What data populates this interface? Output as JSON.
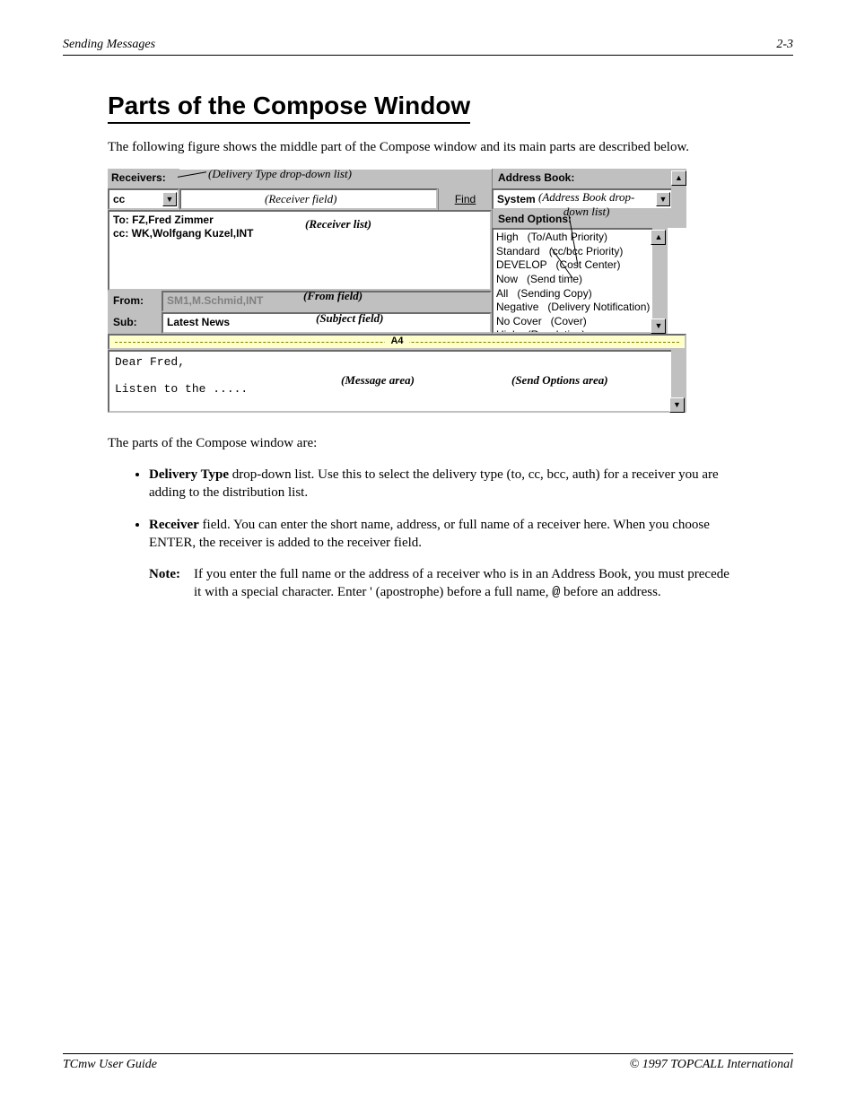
{
  "header": {
    "left": "Sending Messages",
    "right": "2-3"
  },
  "section_title": "Parts of the Compose Window",
  "intro": "The following figure shows the middle part of the Compose window and its main parts are described below.",
  "ui": {
    "receivers_label": "Receivers:",
    "address_book_label": "Address Book:",
    "delivery_type_value": "cc",
    "find_label": "Find",
    "address_book_value": "System",
    "receiver_list": "To: FZ,Fred Zimmer\ncc: WK,Wolfgang Kuzel,INT",
    "send_options_label": "Send Options:",
    "send_options": "High   (To/Auth Priority)\nStandard   (cc/bcc Priority)\nDEVELOP   (Cost Center)\nNow   (Send time)\nAll   (Sending Copy)\nNegative   (Delivery Notification)\nNo Cover   (Cover)\nHigh   (Resolution)",
    "from_label": "From:",
    "from_value": "SM1,M.Schmid,INT",
    "sub_label": "Sub:",
    "sub_value": "Latest News",
    "ruler_label": "A4",
    "message_body": "Dear Fred,\n\nListen to the ....."
  },
  "annotations": {
    "delivery_type": "(Delivery Type drop-down list)",
    "receiver_field": "(Receiver field)",
    "receiver_list": "(Receiver list)",
    "address_book_dd": "(Address Book drop-\ndown list)",
    "from_field": "(From field)",
    "subject_field": "(Subject field)",
    "message_area": "(Message area)",
    "send_options_area": "(Send Options area)"
  },
  "after_figure": "The parts of the Compose window are:",
  "bullets": [
    {
      "label": "Delivery Type",
      "text": " drop-down list. Use this to select the delivery type (to, cc, bcc, auth) for a receiver you are adding to the distribution list."
    },
    {
      "label": "Receiver",
      "text": " field. You can enter the short name, address, or full name of a receiver here. When you choose ENTER, the receiver is added to the receiver field."
    }
  ],
  "note_label": "Note:",
  "note_text": "If you enter the full name or the address of a receiver who is in an Address Book, you must precede it with a special character. Enter ' (apostrophe) before a full name, ",
  "note_tt": "@",
  "note_text2": " before an address.",
  "footer": {
    "left": "TCmw User Guide",
    "right": "© 1997 TOPCALL International"
  }
}
